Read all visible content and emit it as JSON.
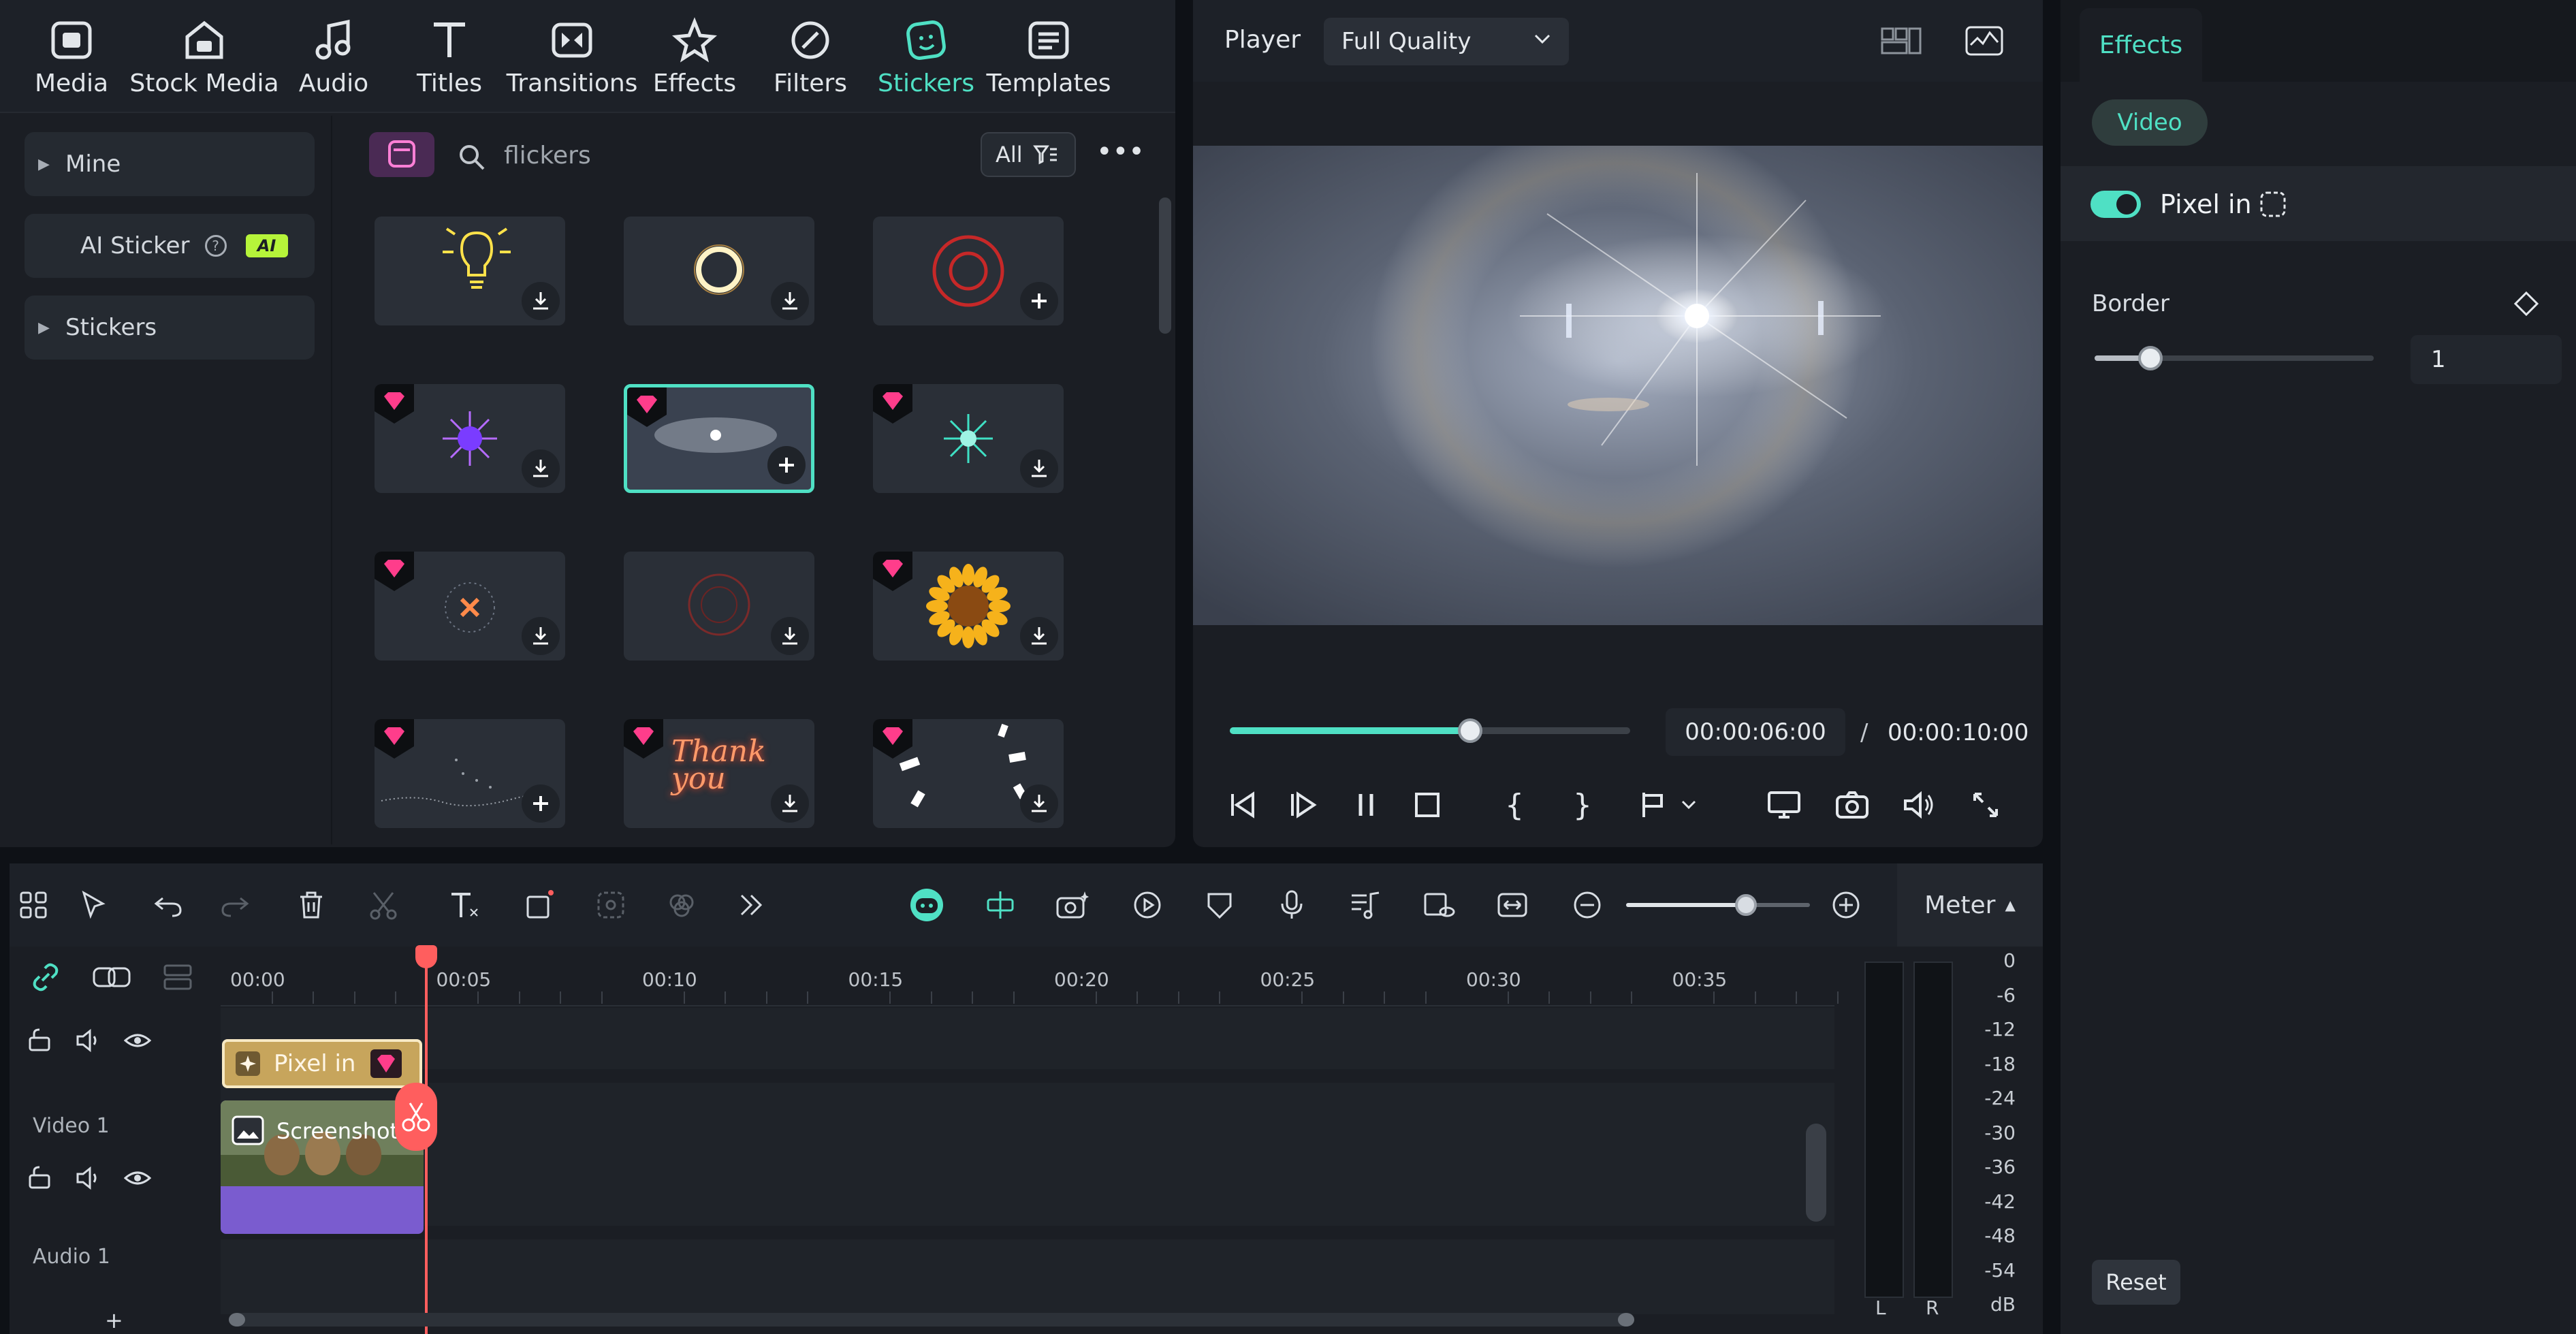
{
  "top_tabs": [
    {
      "label": "Media",
      "icon": "media-icon"
    },
    {
      "label": "Stock Media",
      "icon": "stock-media-icon"
    },
    {
      "label": "Audio",
      "icon": "music-note-icon"
    },
    {
      "label": "Titles",
      "icon": "text-t-icon"
    },
    {
      "label": "Transitions",
      "icon": "transitions-icon"
    },
    {
      "label": "Effects",
      "icon": "effects-star-icon"
    },
    {
      "label": "Filters",
      "icon": "filters-icon"
    },
    {
      "label": "Stickers",
      "icon": "sticker-icon",
      "active": true
    },
    {
      "label": "Templates",
      "icon": "templates-icon"
    }
  ],
  "left_nav": {
    "mine": "Mine",
    "ai_sticker": "AI Sticker",
    "ai_badge": "AI",
    "stickers": "Stickers"
  },
  "search": {
    "value": "flickers",
    "filter_label": "All"
  },
  "sticker_grid": [
    {
      "name": "light-bulb",
      "action": "download"
    },
    {
      "name": "glow-ring",
      "action": "download"
    },
    {
      "name": "red-circle",
      "action": "add"
    },
    {
      "name": "purple-burst",
      "action": "download",
      "premium": true
    },
    {
      "name": "lens-flare",
      "action": "add",
      "premium": true,
      "selected": true
    },
    {
      "name": "teal-burst",
      "action": "download",
      "premium": true
    },
    {
      "name": "orange-spark",
      "action": "download",
      "premium": true
    },
    {
      "name": "faint-circle",
      "action": "download"
    },
    {
      "name": "sunflower",
      "action": "download",
      "premium": true
    },
    {
      "name": "dotted-wave",
      "action": "add",
      "premium": true
    },
    {
      "name": "thank-you-neon",
      "action": "download",
      "premium": true,
      "text": "Thank you"
    },
    {
      "name": "white-dashes",
      "action": "download",
      "premium": true
    }
  ],
  "player": {
    "label": "Player",
    "quality": "Full Quality",
    "current_time": "00:00:06:00",
    "separator": "/",
    "duration": "00:00:10:00",
    "progress": 0.6
  },
  "effects_panel": {
    "tab": "Effects",
    "video_pill": "Video",
    "effect_name": "Pixel in",
    "border_label": "Border",
    "border_value": "1",
    "border_fraction": 0.2,
    "reset_label": "Reset"
  },
  "timeline": {
    "meter_label": "Meter",
    "zoom_fraction": 0.65,
    "ruler": [
      "00:00",
      "00:05",
      "00:10",
      "00:15",
      "00:20",
      "00:25",
      "00:30",
      "00:35"
    ],
    "tracks": {
      "video": "Video 1",
      "audio": "Audio 1"
    },
    "fx_clip": "Pixel in",
    "video_clip": "Screenshot",
    "add_track": "+"
  },
  "meter": {
    "scale": [
      "0",
      "-6",
      "-12",
      "-18",
      "-24",
      "-30",
      "-36",
      "-42",
      "-48",
      "-54",
      "dB"
    ],
    "channels": [
      "L",
      "R"
    ]
  },
  "colors": {
    "accent": "#4fe0c4",
    "playhead": "#ff5e5e",
    "fx_clip": "#c7a55c",
    "video_clip": "#7a5ccf"
  }
}
